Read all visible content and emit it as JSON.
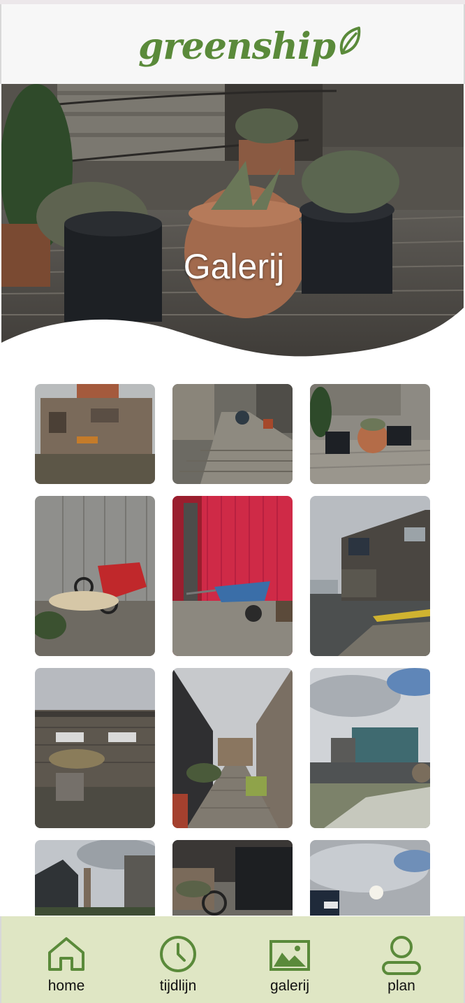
{
  "header": {
    "logo_text": "greenship"
  },
  "hero": {
    "title": "Galerij"
  },
  "gallery": {
    "photos": [
      {
        "alt": "wooden houseboat with garden"
      },
      {
        "alt": "wooden deck walkway with bicycles"
      },
      {
        "alt": "plant pots on deck"
      },
      {
        "alt": "children's bike and ropes by wooden fence"
      },
      {
        "alt": "wheelbarrow in front of red wall"
      },
      {
        "alt": "floating house on water with boat"
      },
      {
        "alt": "houseboat front with reed roof"
      },
      {
        "alt": "narrow deck path between wooden houses"
      },
      {
        "alt": "green houseboat under cloudy sky"
      },
      {
        "alt": "dark houseboats with chimney"
      },
      {
        "alt": "deck with bicycle and fence"
      },
      {
        "alt": "cloudy sky over houseboat"
      }
    ]
  },
  "nav": {
    "items": [
      {
        "label": "home",
        "icon": "home-icon"
      },
      {
        "label": "tijdlijn",
        "icon": "clock-icon"
      },
      {
        "label": "galerij",
        "icon": "gallery-icon"
      },
      {
        "label": "plan",
        "icon": "user-icon"
      }
    ]
  },
  "colors": {
    "brand_green": "#5a8a3a",
    "nav_bg": "#dfe6c4",
    "icon_green": "#5a8a3a"
  }
}
